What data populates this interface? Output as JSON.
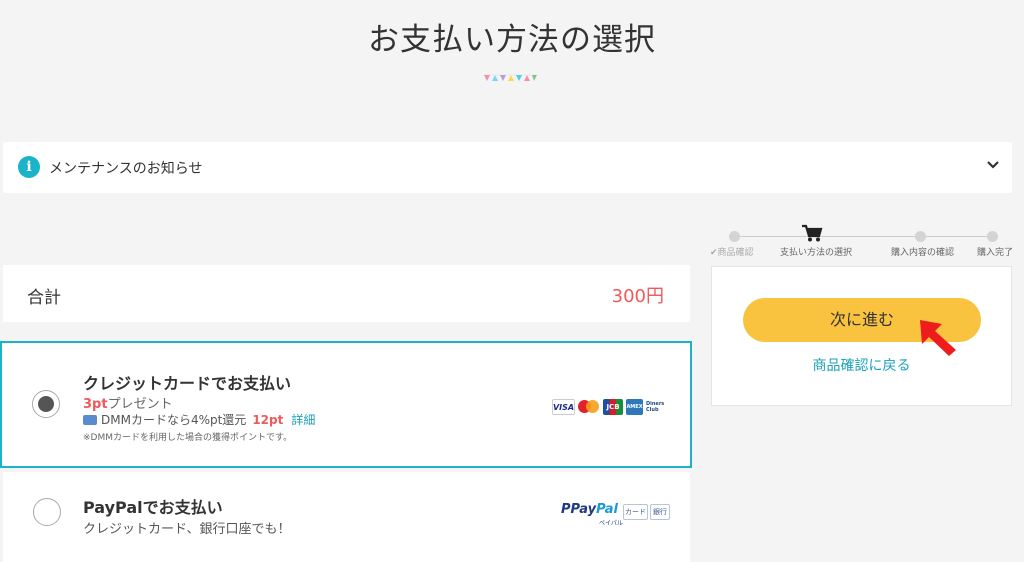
{
  "page": {
    "title": "お支払い方法の選択"
  },
  "notice": {
    "text": "メンテナンスのお知らせ",
    "icon": "info-icon"
  },
  "steps": [
    {
      "label": "商品確認",
      "state": "done"
    },
    {
      "label": "支払い方法の選択",
      "state": "current"
    },
    {
      "label": "購入内容の確認",
      "state": "todo"
    },
    {
      "label": "購入完了",
      "state": "todo"
    }
  ],
  "summary": {
    "total_label": "合計",
    "total_amount": "300円"
  },
  "actions": {
    "next_label": "次に進む",
    "back_label": "商品確認に戻る"
  },
  "payments": [
    {
      "name": "クレジットカードでお支払い",
      "selected": true,
      "points_value": "3pt",
      "points_suffix": "プレゼント",
      "dmm_text": "DMMカードなら4%pt還元",
      "dmm_points": "12pt",
      "dmm_link": "詳細",
      "note": "※DMMカードを利用した場合の獲得ポイントです。",
      "brands": {
        "visa": "VISA",
        "jcb": "JCB",
        "amex": "AMEX",
        "diners": "Diners Club"
      }
    },
    {
      "name": "PayPalでお支払い",
      "selected": false,
      "sub": "クレジットカード、銀行口座でも！",
      "logo_pay": "Pay",
      "logo_pal": "Pal",
      "logo_kana": "ペイパル",
      "tags": [
        "カード",
        "銀行"
      ]
    }
  ],
  "colors": {
    "accent": "#1bb3c9",
    "button": "#f9c33f",
    "price": "#ef5a5a",
    "link": "#1aa2b8"
  }
}
